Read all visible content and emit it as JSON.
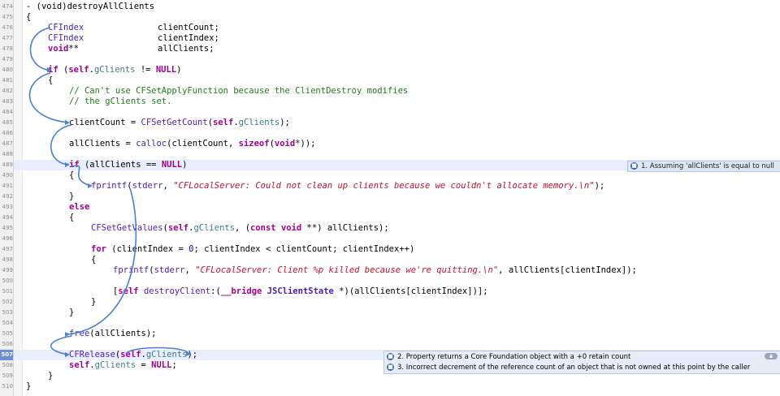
{
  "gutter": {
    "line_numbers": [
      "474",
      "475",
      "476",
      "477",
      "478",
      "479",
      "480",
      "481",
      "482",
      "483",
      "484",
      "485",
      "486",
      "487",
      "488",
      "489",
      "490",
      "491",
      "492",
      "493",
      "494",
      "495",
      "496",
      "497",
      "498",
      "499",
      "500",
      "501",
      "502",
      "503",
      "504",
      "505",
      "506",
      "507",
      "508",
      "509",
      "510"
    ],
    "active_line": "507"
  },
  "code": {
    "l474": "- (void)destroyAllClients",
    "l475": "{",
    "l476_type": "CFIndex",
    "l476_var": "clientCount;",
    "l477_type": "CFIndex",
    "l477_var": "clientIndex;",
    "l478_type": "void",
    "l478_ptr": "**",
    "l478_var": "allClients;",
    "l480_kw": "if",
    "l480_a": " (",
    "l480_self": "self",
    "l480_b": ".",
    "l480_prop": "gClients",
    "l480_c": " != ",
    "l480_null": "NULL",
    "l480_d": ")",
    "l481": "{",
    "l482": "// Can't use CFSetApplyFunction because the ClientDestroy modifies",
    "l483": "// the gClients set.",
    "l485_a": "clientCount = ",
    "l485_fn": "CFSetGetCount",
    "l485_b": "(",
    "l485_self": "self",
    "l485_c": ".",
    "l485_prop": "gClients",
    "l485_d": ");",
    "l487_a": "allClients = ",
    "l487_fn": "calloc",
    "l487_b": "(clientCount, ",
    "l487_kw": "sizeof",
    "l487_c": "(",
    "l487_kw2": "void",
    "l487_d": "*));",
    "l489_kw": "if",
    "l489_a": " (allClients == ",
    "l489_null": "NULL",
    "l489_b": ")",
    "l490": "{",
    "l491_fn": "fprintf",
    "l491_a": "(",
    "l491_stderr": "stderr",
    "l491_b": ", ",
    "l491_str": "\"CFLocalServer: Could not clean up clients because we couldn't allocate memory.\\n\"",
    "l491_c": ");",
    "l492": "}",
    "l493": "else",
    "l494": "{",
    "l495_fn": "CFSetGetValues",
    "l495_a": "(",
    "l495_self": "self",
    "l495_b": ".",
    "l495_prop": "gClients",
    "l495_c": ", (",
    "l495_kw": "const void",
    "l495_d": " **) allClients);",
    "l497_kw": "for",
    "l497_a": " (clientIndex = ",
    "l497_num": "0",
    "l497_b": "; clientIndex < clientCount; clientIndex++)",
    "l498": "{",
    "l499_fn": "fprintf",
    "l499_a": "(",
    "l499_stderr": "stderr",
    "l499_b": ", ",
    "l499_str": "\"CFLocalServer: Client %p killed because we're quitting.\\n\"",
    "l499_c": ", allClients[clientIndex]);",
    "l501_a": "[",
    "l501_self": "self",
    "l501_sel": " destroyClient",
    "l501_b": ":(",
    "l501_kw": "__bridge",
    "l501_c": " ",
    "l501_cls": "JSClientState",
    "l501_d": " *)(allClients[clientIndex])];",
    "l502": "}",
    "l503": "}",
    "l505_fn": "free",
    "l505_a": "(allClients);",
    "l507_fn": "CFRelease",
    "l507_a": "(",
    "l507_self": "self",
    "l507_b": ".",
    "l507_prop": "gClients",
    "l507_c": ");",
    "l508_self": "self",
    "l508_a": ".",
    "l508_prop": "gClients",
    "l508_b": " = ",
    "l508_null": "NULL",
    "l508_c": ";",
    "l509": "}",
    "l510": "}"
  },
  "annotations": {
    "a1": {
      "num": "1",
      "text": "1. Assuming 'allClients' is equal to null"
    },
    "a2": {
      "num": "2",
      "text": "2. Property returns a Core Foundation object with a +0 retain count"
    },
    "a3": {
      "num": "3",
      "text": "3. Incorrect decrement of the reference count of an object that is not owned at this point by the caller"
    },
    "collapse_icon": "triangle-up-icon"
  },
  "colors": {
    "keyword": "#a2008f",
    "comment": "#237c1c",
    "string": "#c4122a",
    "arrow": "#4a7fd4",
    "active_line": "#6b8fd6"
  }
}
